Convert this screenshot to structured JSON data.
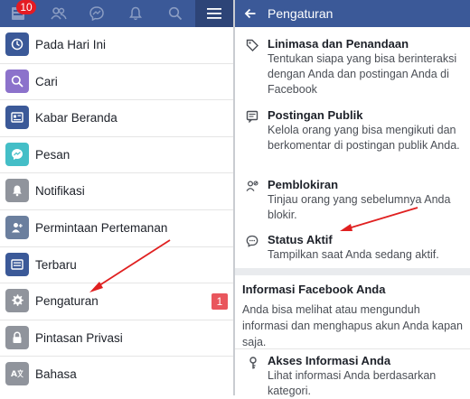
{
  "topnav": {
    "notification_count": "10",
    "icons": [
      "news-feed-icon",
      "friends-icon",
      "messenger-icon",
      "bell-icon",
      "search-icon",
      "menu-icon"
    ]
  },
  "menu": {
    "items": [
      {
        "label": "Pada Hari Ini",
        "icon": "on-this-day-icon",
        "color": "#3b5998"
      },
      {
        "label": "Cari",
        "icon": "search-icon",
        "color": "#8c72cb"
      },
      {
        "label": "Kabar Beranda",
        "icon": "news-feed-icon",
        "color": "#3b5998"
      },
      {
        "label": "Pesan",
        "icon": "messenger-icon",
        "color": "#44bec7"
      },
      {
        "label": "Notifikasi",
        "icon": "bell-icon",
        "color": "#90949c"
      },
      {
        "label": "Permintaan Pertemanan",
        "icon": "friend-request-icon",
        "color": "#6b7f9e"
      },
      {
        "label": "Terbaru",
        "icon": "recent-icon",
        "color": "#3b5998"
      },
      {
        "label": "Pengaturan",
        "icon": "gear-icon",
        "color": "#90949c",
        "badge": "1"
      },
      {
        "label": "Pintasan Privasi",
        "icon": "lock-icon",
        "color": "#90949c"
      },
      {
        "label": "Bahasa",
        "icon": "language-icon",
        "color": "#90949c"
      }
    ]
  },
  "settings_panel": {
    "title": "Pengaturan",
    "items": [
      {
        "title": "Linimasa dan Penandaan",
        "desc": "Tentukan siapa yang bisa berinteraksi dengan Anda dan postingan Anda di Facebook",
        "icon": "tag-icon"
      },
      {
        "title": "Postingan Publik",
        "desc": "Kelola orang yang bisa mengikuti dan berkomentar di postingan publik Anda.",
        "icon": "public-post-icon"
      },
      {
        "title": "Pemblokiran",
        "desc": "Tinjau orang yang sebelumnya Anda blokir.",
        "icon": "block-user-icon"
      },
      {
        "title": "Status Aktif",
        "desc": "Tampilkan saat Anda sedang aktif.",
        "icon": "active-status-icon"
      }
    ],
    "section": {
      "title": "Informasi Facebook Anda",
      "desc": "Anda bisa melihat atau mengunduh informasi dan menghapus akun Anda kapan saja."
    },
    "access_item": {
      "title": "Akses Informasi Anda",
      "desc": "Lihat informasi Anda berdasarkan kategori.",
      "icon": "key-icon"
    }
  },
  "colors": {
    "brand": "#3b5998",
    "badge": "#e41b23",
    "annotation": "#e02020"
  }
}
